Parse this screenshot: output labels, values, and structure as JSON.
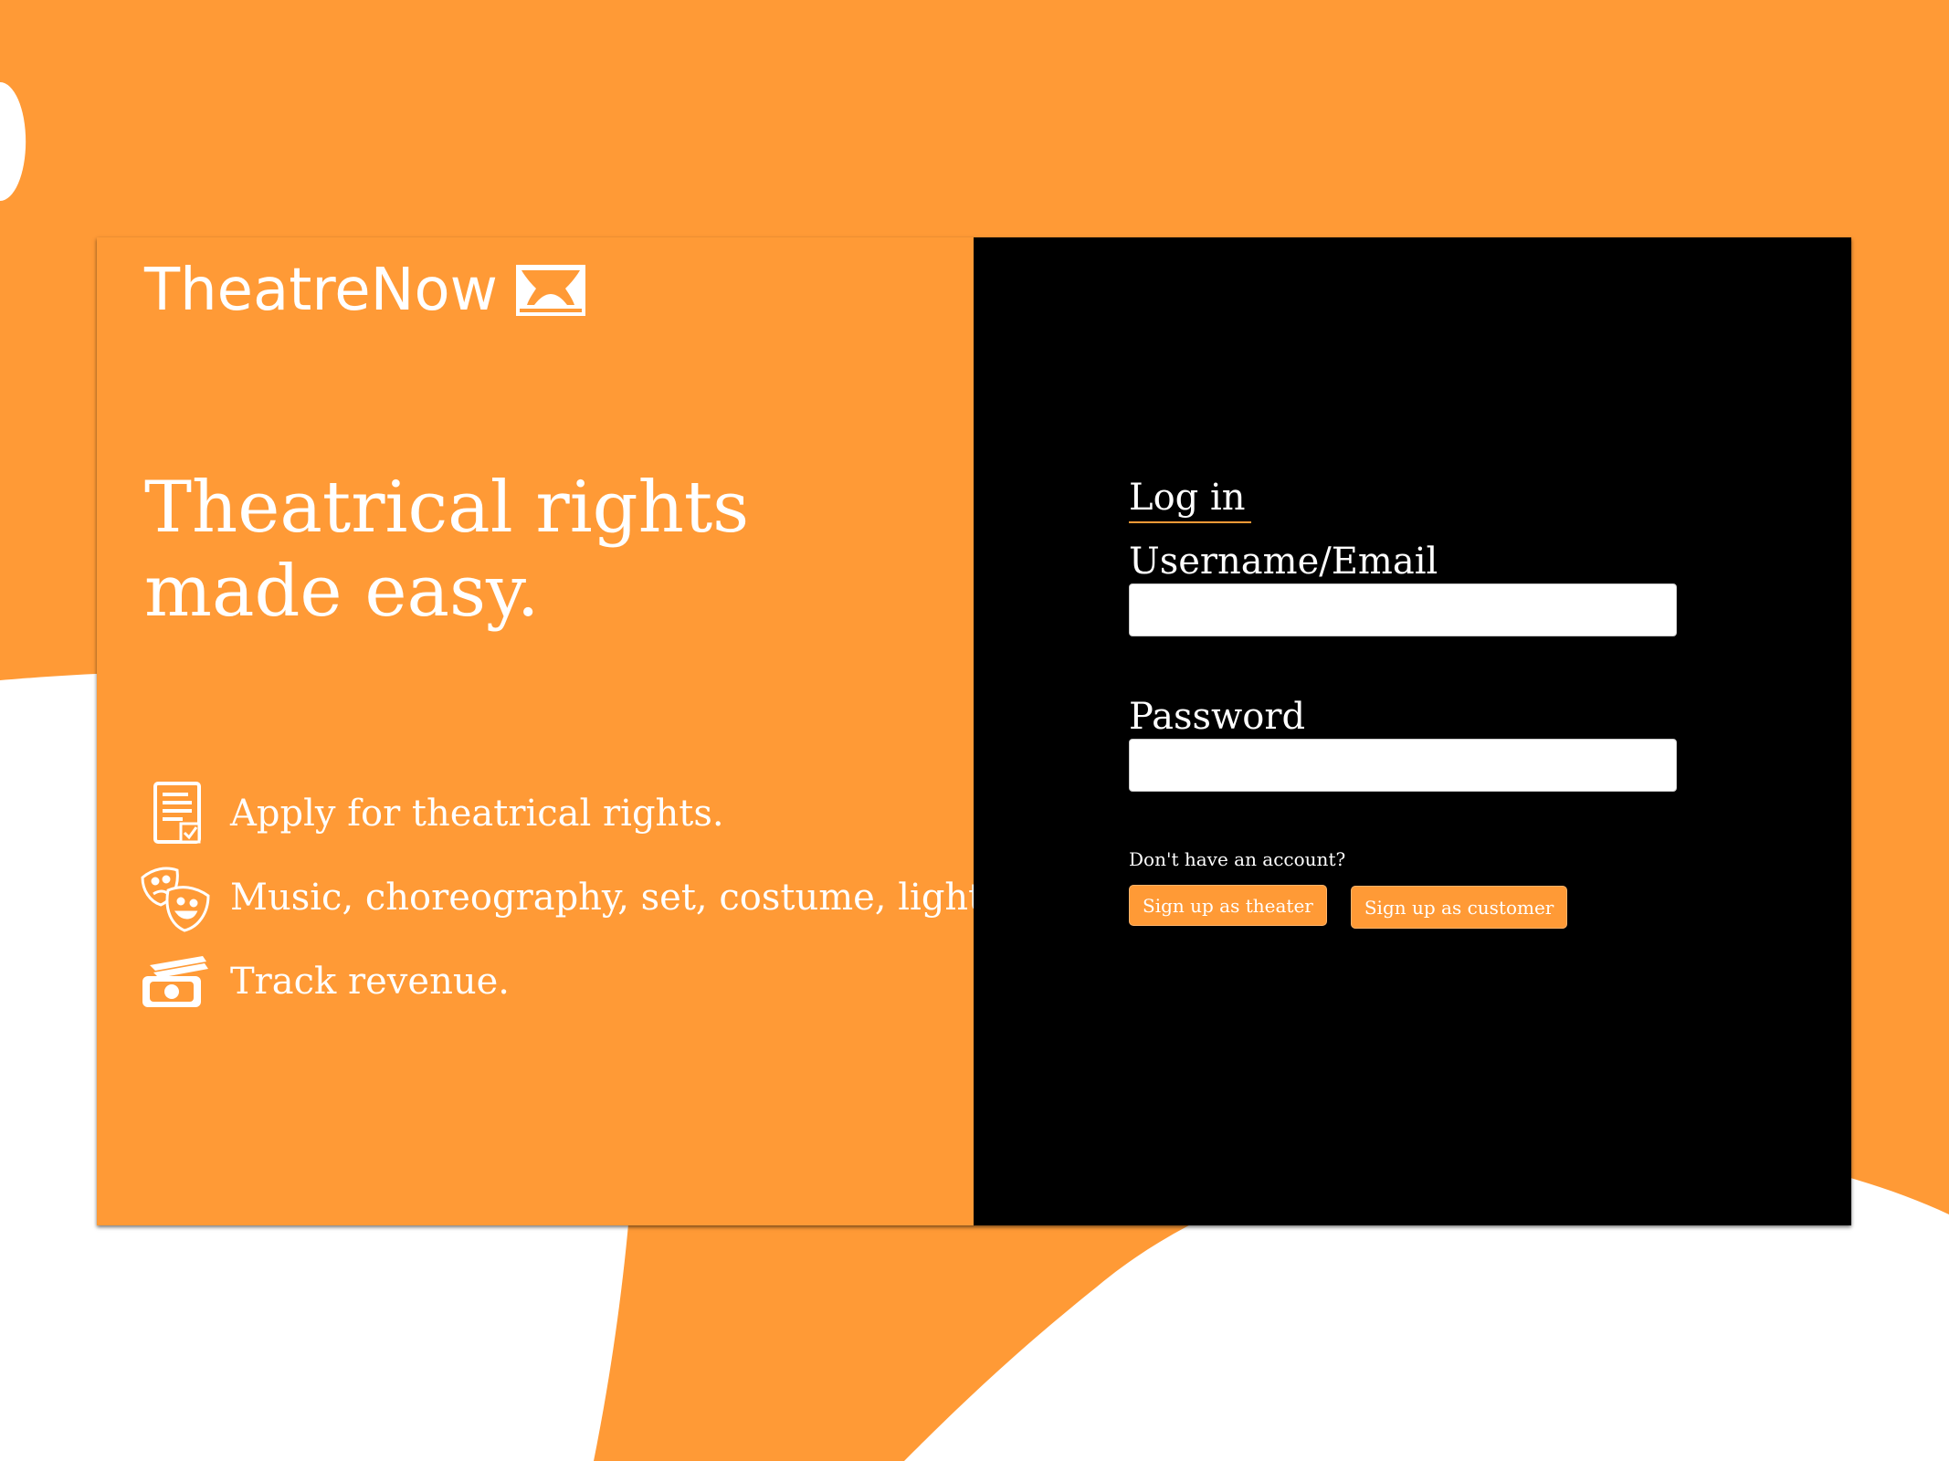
{
  "brand": {
    "name": "TheatreNow",
    "icon": "theater-curtain-icon"
  },
  "headline": {
    "line1": "Theatrical rights",
    "line2": "made easy."
  },
  "features": [
    {
      "icon": "document-checklist-icon",
      "text": "Apply for theatrical rights."
    },
    {
      "icon": "theater-masks-icon",
      "text": "Music, choreography, set, costume, lighting."
    },
    {
      "icon": "cash-icon",
      "text": "Track revenue."
    }
  ],
  "login": {
    "title": "Log in",
    "username_label": "Username/Email",
    "username_value": "",
    "password_label": "Password",
    "password_value": "",
    "signup_prompt": "Don't have an account?",
    "signup_theater": "Sign up as theater",
    "signup_customer": "Sign up as customer"
  },
  "colors": {
    "accent": "#FF9A36",
    "dark": "#000000",
    "light": "#FFFFFF"
  }
}
